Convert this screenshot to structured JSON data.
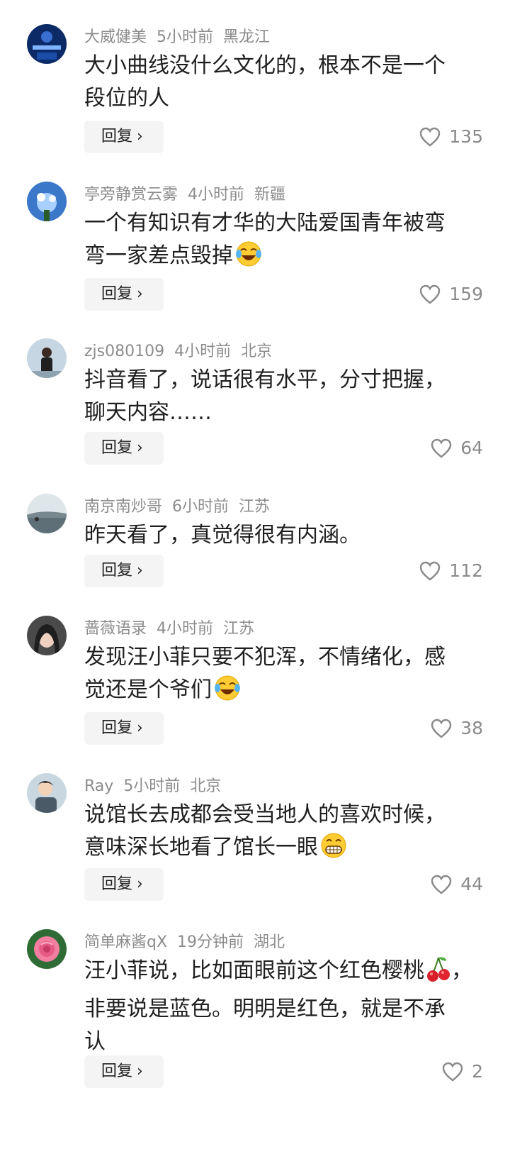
{
  "reply_label": "回复",
  "comments": [
    {
      "user": "大威健美",
      "time": "5小时前",
      "location": "黑龙江",
      "lines": [
        "大小曲线没什么文化的，根本不是一个",
        "段位的人"
      ],
      "emoji": "",
      "likes": "135"
    },
    {
      "user": "亭旁静赏云雾",
      "time": "4小时前",
      "location": "新疆",
      "lines": [
        "一个有知识有才华的大陆爱国青年被弯",
        "弯一家差点毁掉"
      ],
      "emoji": "laughing-crying-emoji",
      "likes": "159"
    },
    {
      "user": "zjs080109",
      "time": "4小时前",
      "location": "北京",
      "lines": [
        "抖音看了，说话很有水平，分寸把握，",
        "聊天内容……"
      ],
      "emoji": "",
      "likes": "64"
    },
    {
      "user": "南京南炒哥",
      "time": "6小时前",
      "location": "江苏",
      "lines": [
        "昨天看了，真觉得很有内涵。"
      ],
      "emoji": "",
      "likes": "112"
    },
    {
      "user": "蔷薇语录",
      "time": "4小时前",
      "location": "江苏",
      "lines": [
        "发现汪小菲只要不犯浑，不情绪化，感",
        "觉还是个爷们"
      ],
      "emoji": "laughing-crying-emoji",
      "likes": "38"
    },
    {
      "user": "Ray",
      "time": "5小时前",
      "location": "北京",
      "lines": [
        "说馆长去成都会受当地人的喜欢时候，",
        "意味深长地看了馆长一眼"
      ],
      "emoji": "grinning-emoji",
      "likes": "44"
    },
    {
      "user": "简单麻酱qX",
      "time": "19分钟前",
      "location": "湖北",
      "lines": [
        "汪小菲说，比如面眼前这个红色樱桃",
        "非要说是蓝色。明明是红色，就是不承",
        "认"
      ],
      "emoji": "cherry-emoji",
      "likes": "2"
    }
  ]
}
